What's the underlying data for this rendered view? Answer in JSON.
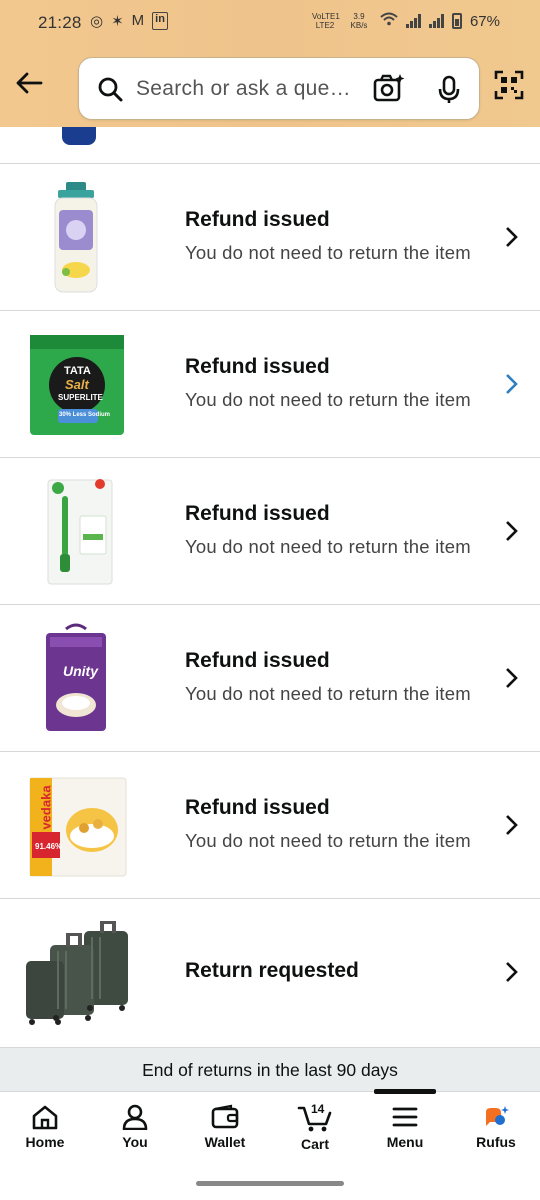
{
  "status_bar": {
    "time": "21:28",
    "network": "VoLTE1 LTE2",
    "speed": "3.9 KB/s",
    "battery": "67%"
  },
  "header": {
    "search_placeholder": "Search or ask a que…"
  },
  "returns": [
    {
      "status": "Refund issued",
      "note": "You do not need to return the item",
      "product_icon": "shampoo-bottle"
    },
    {
      "status": "Refund issued",
      "note": "You do not need to return the item",
      "product_icon": "salt-pack"
    },
    {
      "status": "Refund issued",
      "note": "You do not need to return the item",
      "product_icon": "toothbrush-pack"
    },
    {
      "status": "Refund issued",
      "note": "You do not need to return the item",
      "product_icon": "rice-bag"
    },
    {
      "status": "Refund issued",
      "note": "You do not need to return the item",
      "product_icon": "cornflakes-pack"
    },
    {
      "status": "Return requested",
      "note": "",
      "product_icon": "luggage-set"
    }
  ],
  "product_labels": {
    "salt_brand": "TATA",
    "salt_name": "Salt",
    "salt_variant": "SUPERLITE",
    "salt_claim": "30% Less Sodium",
    "rice_name": "Unity",
    "cornflakes_brand": "vedaka",
    "cornflakes_claim": "91.46%"
  },
  "end_text": "End of returns in the last 90 days",
  "tabs": [
    {
      "label": "Home",
      "icon": "home-icon"
    },
    {
      "label": "You",
      "icon": "user-icon"
    },
    {
      "label": "Wallet",
      "icon": "wallet-icon"
    },
    {
      "label": "Cart",
      "icon": "cart-icon",
      "count": "14"
    },
    {
      "label": "Menu",
      "icon": "menu-icon"
    },
    {
      "label": "Rufus",
      "icon": "rufus-icon"
    }
  ],
  "colors": {
    "header_bg": "#f0c68e",
    "chevron_active": "#2f7fc1",
    "rufus_orange": "#f37021",
    "rufus_blue": "#1f6fd1"
  }
}
